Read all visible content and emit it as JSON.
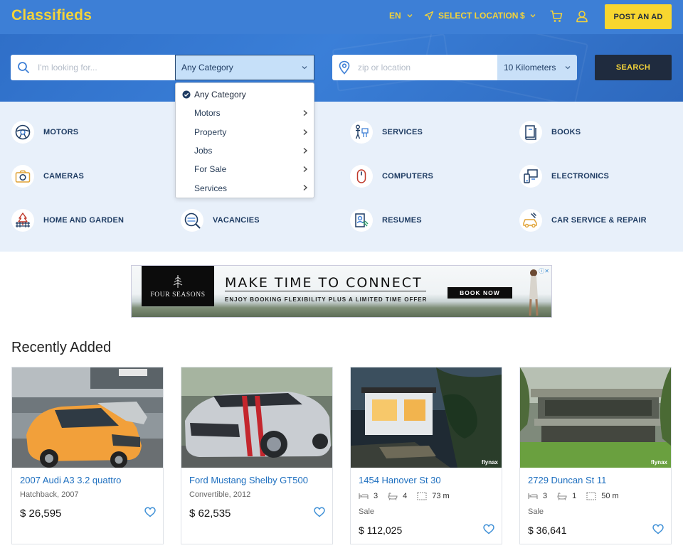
{
  "header": {
    "logo": "Classifieds",
    "language": "EN",
    "location_label": "SELECT LOCATION",
    "currency": "$",
    "post_ad_label": "POST AN AD"
  },
  "search": {
    "keyword_placeholder": "I'm looking for...",
    "category_selected": "Any Category",
    "location_placeholder": "zip or location",
    "radius_selected": "10 Kilometers",
    "search_label": "SEARCH"
  },
  "category_dropdown": {
    "items": [
      {
        "label": "Any Category",
        "selected": true
      },
      {
        "label": "Motors",
        "submenu": true
      },
      {
        "label": "Property",
        "submenu": true
      },
      {
        "label": "Jobs",
        "submenu": true
      },
      {
        "label": "For Sale",
        "submenu": true
      },
      {
        "label": "Services",
        "submenu": true
      }
    ]
  },
  "categories": [
    {
      "label": "MOTORS",
      "icon": "steering-wheel-icon"
    },
    {
      "label": "SERVICES",
      "icon": "services-icon"
    },
    {
      "label": "BOOKS",
      "icon": "book-icon"
    },
    {
      "label": "CAMERAS",
      "icon": "camera-icon"
    },
    {
      "label": "COMPUTERS",
      "icon": "mouse-icon"
    },
    {
      "label": "ELECTRONICS",
      "icon": "devices-icon"
    },
    {
      "label": "HOME AND GARDEN",
      "icon": "garden-icon"
    },
    {
      "label": "VACANCIES",
      "icon": "jobs-search-icon"
    },
    {
      "label": "RESUMES",
      "icon": "resume-icon"
    },
    {
      "label": "CAR SERVICE & REPAIR",
      "icon": "car-repair-icon"
    }
  ],
  "ad": {
    "brand": "FOUR SEASONS",
    "headline": "MAKE TIME TO CONNECT",
    "subline": "ENJOY BOOKING FLEXIBILITY PLUS A LIMITED TIME OFFER",
    "cta": "BOOK NOW"
  },
  "recent": {
    "title": "Recently Added",
    "listings": [
      {
        "title": "2007 Audi A3 3.2 quattro",
        "subtitle": "Hatchback, 2007",
        "price": "$ 26,595"
      },
      {
        "title": "Ford Mustang Shelby GT500",
        "subtitle": "Convertible, 2012",
        "price": "$ 62,535"
      },
      {
        "title": "1454 Hanover St 30",
        "beds": "3",
        "baths": "4",
        "area": "73 m",
        "type": "Sale",
        "price": "$ 112,025",
        "watermark": "flynax"
      },
      {
        "title": "2729 Duncan St 11",
        "beds": "3",
        "baths": "1",
        "area": "50 m",
        "type": "Sale",
        "price": "$ 36,641",
        "watermark": "flynax"
      }
    ]
  },
  "colors": {
    "header_blue": "#3d7fd6",
    "accent_yellow": "#f3d33a",
    "category_bg": "#e8f0fa",
    "link_blue": "#1e6fbf"
  }
}
